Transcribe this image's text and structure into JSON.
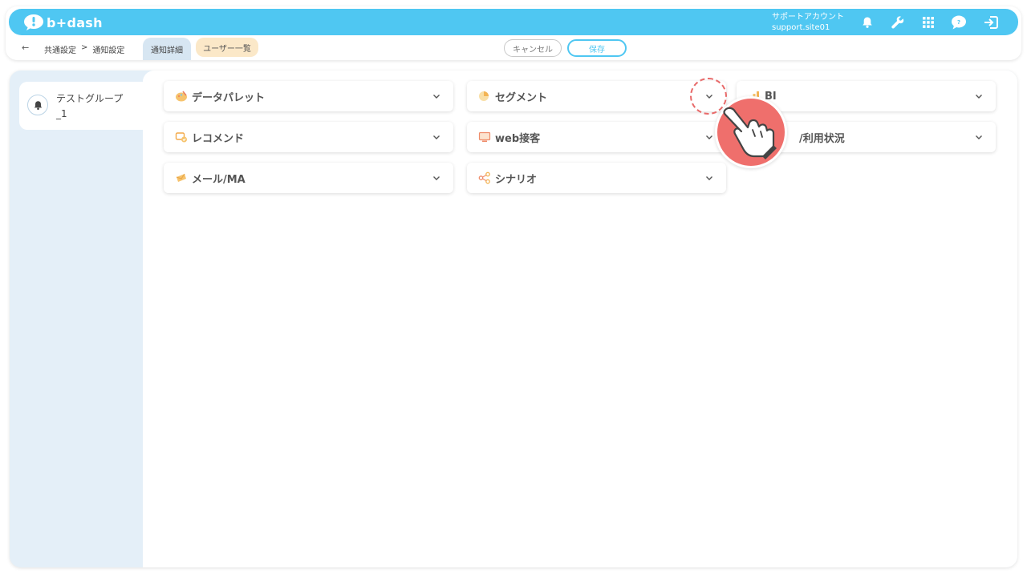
{
  "app": {
    "logo_text": "b+dash",
    "brand_color": "#4fc7f2"
  },
  "header": {
    "account_label": "サポートアカウント",
    "account_site": "support.site01",
    "icons": [
      "bell-icon",
      "wrench-icon",
      "grid-icon",
      "help-icon",
      "logout-icon"
    ]
  },
  "subbar": {
    "breadcrumb": [
      "共通設定",
      ">",
      "通知設定"
    ],
    "tabs": [
      {
        "label": "通知詳細",
        "active": true
      },
      {
        "label": "ユーザー一覧",
        "active": false
      }
    ],
    "cancel_label": "キャンセル",
    "save_label": "保存"
  },
  "sidebar": {
    "groups": [
      {
        "label": "テストグループ_1",
        "icon": "bell-icon"
      }
    ]
  },
  "categories": [
    {
      "label": "データパレット",
      "icon": "palette-icon"
    },
    {
      "label": "セグメント",
      "icon": "segment-icon"
    },
    {
      "label": "BI",
      "icon": "bi-icon"
    },
    {
      "label": "レコメンド",
      "icon": "recommend-icon"
    },
    {
      "label": "web接客",
      "icon": "web-icon"
    },
    {
      "label": "/利用状況",
      "icon": "usage-icon"
    },
    {
      "label": "メール/MA",
      "icon": "mail-icon"
    },
    {
      "label": "シナリオ",
      "icon": "scenario-icon"
    }
  ]
}
